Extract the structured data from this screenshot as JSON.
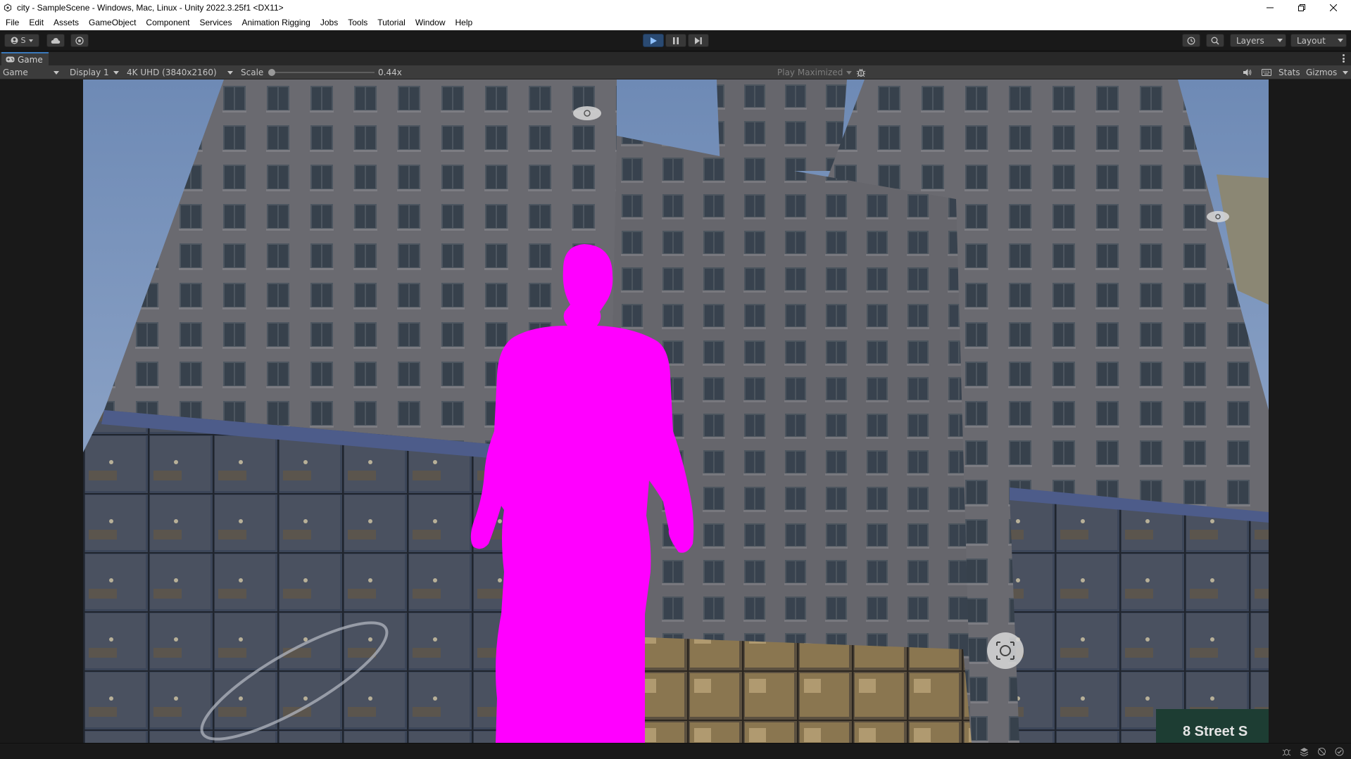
{
  "window": {
    "title": "city - SampleScene - Windows, Mac, Linux - Unity 2022.3.25f1 <DX11>"
  },
  "menu": [
    "File",
    "Edit",
    "Assets",
    "GameObject",
    "Component",
    "Services",
    "Animation Rigging",
    "Jobs",
    "Tools",
    "Tutorial",
    "Window",
    "Help"
  ],
  "toolbar": {
    "account_label": "S",
    "layers_label": "Layers",
    "layout_label": "Layout",
    "play_active": true
  },
  "tab": {
    "label": "Game"
  },
  "gamebar": {
    "view_mode": "Game",
    "display": "Display 1",
    "resolution": "4K UHD (3840x2160)",
    "scale_label": "Scale",
    "scale_value": "0.44x",
    "play_mode": "Play Maximized",
    "stats_label": "Stats",
    "gizmos_label": "Gizmos"
  },
  "scene": {
    "sky_color": "#7d97bd",
    "building_color": "#65656b",
    "window_color": "#3a4450",
    "character_color": "#ff00ff",
    "storefront_color": "#3a4558",
    "sign_text": "8 Street S"
  }
}
